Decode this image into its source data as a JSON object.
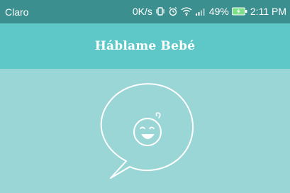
{
  "status_bar": {
    "carrier": "Claro",
    "network_speed": "0K/s",
    "battery_percent": "49%",
    "time": "2:11 PM",
    "icons": [
      "vibrate-icon",
      "alarm-icon",
      "wifi-icon",
      "signal-icon",
      "battery-charging-icon"
    ]
  },
  "header": {
    "title": "Háblame Bebé"
  },
  "main": {
    "logo_icon": "speech-bubble-baby-face-icon"
  },
  "colors": {
    "status_bar": "#3c8f8f",
    "header": "#5ec8c8",
    "background": "#9ad6d6",
    "foreground": "#ffffff",
    "battery_fill": "#7ee08a"
  }
}
